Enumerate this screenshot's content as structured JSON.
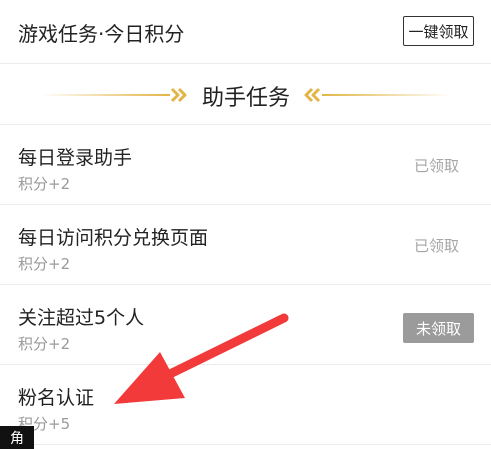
{
  "header": {
    "title": "游戏任务·今日积分",
    "claim_all_label": "一键领取"
  },
  "section": {
    "title": "助手任务",
    "accent_color": "#e3b547"
  },
  "tasks": [
    {
      "name": "每日登录助手",
      "points": "积分+2",
      "status": "已领取",
      "claimable": false
    },
    {
      "name": "每日访问积分兑换页面",
      "points": "积分+2",
      "status": "已领取",
      "claimable": false
    },
    {
      "name": "关注超过5个人",
      "points": "积分+2",
      "status": "未领取",
      "claimable": true
    },
    {
      "name": "粉名认证",
      "points": "积分+5",
      "status": "",
      "claimable": false
    }
  ],
  "annotation": {
    "arrow_color": "#f23a3a"
  },
  "corner_badge": "角"
}
